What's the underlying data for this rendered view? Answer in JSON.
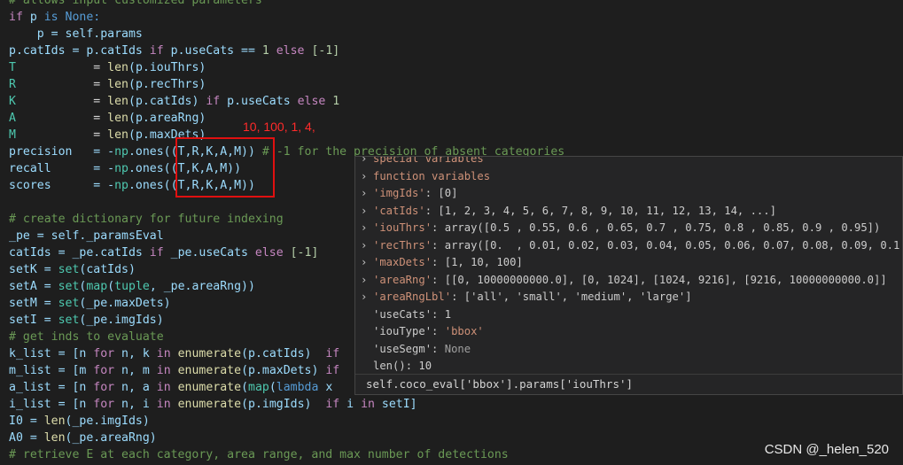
{
  "code": {
    "l0": "# allows input customized parameters",
    "l1a": "if",
    "l1b": " p ",
    "l1c": "is",
    "l1d": " None:",
    "l2": "    p = self.params",
    "l3a": "p.catIds = p.catIds ",
    "l3b": "if",
    "l3c": " p.useCats == ",
    "l3d": "1",
    "l3e": " else ",
    "l3f": "[-1]",
    "l4a": "T",
    "l4b": "           = ",
    "l4c": "len",
    "l4d": "(p.iouThrs)",
    "l5a": "R",
    "l5b": "           = ",
    "l5c": "len",
    "l5d": "(p.recThrs)",
    "l6a": "K",
    "l6b": "           = ",
    "l6c": "len",
    "l6d": "(p.catIds) ",
    "l6e": "if",
    "l6f": " p.useCats ",
    "l6g": "else",
    "l6h": " 1",
    "l7a": "A",
    "l7b": "           = ",
    "l7c": "len",
    "l7d": "(p.areaRng)",
    "l8a": "M",
    "l8b": "           = ",
    "l8c": "len",
    "l8d": "(p.maxDets)",
    "l9a": "precision   = -",
    "l9b": "np",
    "l9c": ".ones((T,R,K,A,M)) ",
    "l9d": "# -1 for the precision of absent categories",
    "l10a": "recall      = -",
    "l10b": "np",
    "l10c": ".ones((T,K,A,M))",
    "l11a": "scores      = -",
    "l11b": "np",
    "l11c": ".ones((T,R,K,A,M))",
    "l13": "# create dictionary for future indexing",
    "l14": "_pe = self._paramsEval",
    "l15a": "catIds = _pe.catIds ",
    "l15b": "if",
    "l15c": " _pe.useCats ",
    "l15d": "else",
    "l15e": " [-1]",
    "l16a": "setK = ",
    "l16b": "set",
    "l16c": "(catIds)",
    "l17a": "setA = ",
    "l17b": "set",
    "l17c": "(",
    "l17d": "map",
    "l17e": "(",
    "l17f": "tuple",
    "l17g": ", _pe.areaRng))",
    "l18a": "setM = ",
    "l18b": "set",
    "l18c": "(_pe.maxDets)",
    "l19a": "setI = ",
    "l19b": "set",
    "l19c": "(_pe.imgIds)",
    "l20": "# get inds to evaluate",
    "l21a": "k_list = [n ",
    "l21b": "for",
    "l21c": " n, k ",
    "l21d": "in",
    "l21e": " ",
    "l21f": "enumerate",
    "l21g": "(p.catIds)  ",
    "l21h": "if",
    "l22a": "m_list = [m ",
    "l22b": "for",
    "l22c": " n, m ",
    "l22d": "in",
    "l22e": " ",
    "l22f": "enumerate",
    "l22g": "(p.maxDets) ",
    "l22h": "if",
    "l23a": "a_list = [n ",
    "l23b": "for",
    "l23c": " n, a ",
    "l23d": "in",
    "l23e": " ",
    "l23f": "enumerate",
    "l23g": "(",
    "l23h": "map",
    "l23i": "(",
    "l23j": "lambda",
    "l23k": " x",
    "l24a": "i_list = [n ",
    "l24b": "for",
    "l24c": " n, i ",
    "l24d": "in",
    "l24e": " ",
    "l24f": "enumerate",
    "l24g": "(p.imgIds)  ",
    "l24h": "if",
    "l24i": " i ",
    "l24j": "in",
    "l24k": " setI]",
    "l25a": "I0 = ",
    "l25b": "len",
    "l25c": "(_pe.imgIds)",
    "l26a": "A0 = ",
    "l26b": "len",
    "l26c": "(_pe.areaRng)",
    "l27": "# retrieve E at each category, area range, and max number of detections"
  },
  "annotation": "10, 100, 1, 4,",
  "hover": {
    "rows": [
      {
        "chev": "›",
        "key": "special variables",
        "sep": "",
        "val": ""
      },
      {
        "chev": "›",
        "key": "function variables",
        "sep": "",
        "val": ""
      },
      {
        "chev": "›",
        "key": "'imgIds'",
        "sep": ": ",
        "val": "[0]"
      },
      {
        "chev": "›",
        "key": "'catIds'",
        "sep": ": ",
        "val": "[1, 2, 3, 4, 5, 6, 7, 8, 9, 10, 11, 12, 13, 14, ...]"
      },
      {
        "chev": "›",
        "key": "'iouThrs'",
        "sep": ": ",
        "val": "array([0.5 , 0.55, 0.6 , 0.65, 0.7 , 0.75, 0.8 , 0.85, 0.9 , 0.95])"
      },
      {
        "chev": "›",
        "key": "'recThrs'",
        "sep": ": ",
        "val": "array([0.  , 0.01, 0.02, 0.03, 0.04, 0.05, 0.06, 0.07, 0.08, 0.09, 0.1 ,"
      },
      {
        "chev": "›",
        "key": "'maxDets'",
        "sep": ": ",
        "val": "[1, 10, 100]"
      },
      {
        "chev": "›",
        "key": "'areaRng'",
        "sep": ": ",
        "val": "[[0, 10000000000.0], [0, 1024], [1024, 9216], [9216, 10000000000.0]]"
      },
      {
        "chev": "›",
        "key": "'areaRngLbl'",
        "sep": ": ",
        "val": "['all', 'small', 'medium', 'large']"
      },
      {
        "chev": "",
        "key": "'useCats'",
        "sep": ": ",
        "val": "1"
      },
      {
        "chev": "",
        "key": "'iouType'",
        "sep": ": ",
        "val": "'bbox'"
      },
      {
        "chev": "",
        "key": "'useSegm'",
        "sep": ": ",
        "val": "None"
      },
      {
        "chev": "",
        "key": "len()",
        "sep": ": ",
        "val": "10"
      }
    ],
    "footer": "self.coco_eval['bbox'].params['iouThrs']"
  },
  "watermark": "CSDN @_helen_520"
}
